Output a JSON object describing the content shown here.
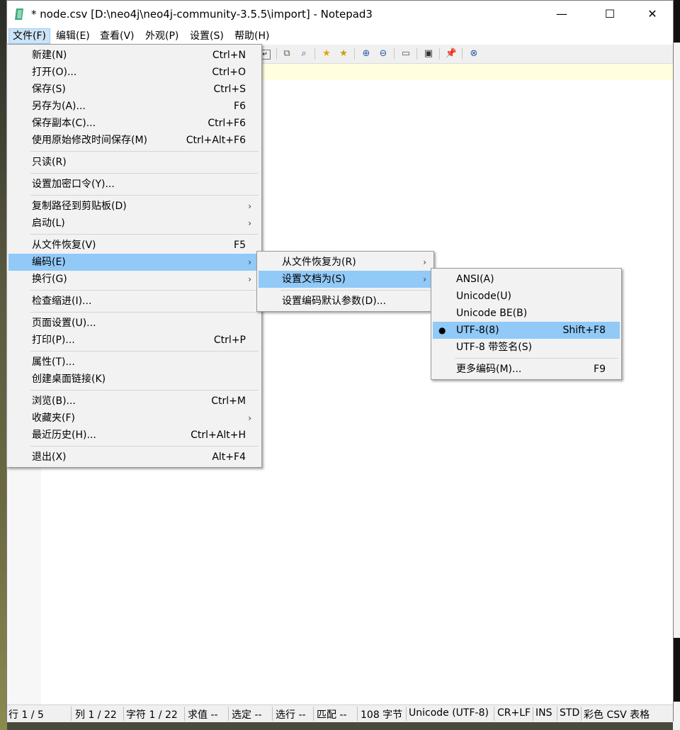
{
  "window": {
    "title": "* node.csv [D:\\neo4j\\neo4j-community-3.5.5\\import] - Notepad3",
    "minimize": "—",
    "maximize": "☐",
    "close": "✕"
  },
  "menubar": [
    "文件(F)",
    "编辑(E)",
    "查看(V)",
    "外观(P)",
    "设置(S)",
    "帮助(H)"
  ],
  "file_menu": [
    {
      "label": "新建(N)",
      "shortcut": "Ctrl+N"
    },
    {
      "label": "打开(O)...",
      "shortcut": "Ctrl+O"
    },
    {
      "label": "保存(S)",
      "shortcut": "Ctrl+S"
    },
    {
      "label": "另存为(A)...",
      "shortcut": "F6"
    },
    {
      "label": "保存副本(C)...",
      "shortcut": "Ctrl+F6"
    },
    {
      "label": "使用原始修改时间保存(M)",
      "shortcut": "Ctrl+Alt+F6"
    },
    {
      "label": "只读(R)",
      "shortcut": ""
    },
    {
      "label": "设置加密口令(Y)...",
      "shortcut": ""
    },
    {
      "label": "复制路径到剪贴板(D)",
      "shortcut": "",
      "submenu": true
    },
    {
      "label": "启动(L)",
      "shortcut": "",
      "submenu": true
    },
    {
      "label": "从文件恢复(V)",
      "shortcut": "F5"
    },
    {
      "label": "编码(E)",
      "shortcut": "",
      "submenu": true,
      "highlighted": true
    },
    {
      "label": "换行(G)",
      "shortcut": "",
      "submenu": true
    },
    {
      "label": "检查缩进(I)...",
      "shortcut": ""
    },
    {
      "label": "页面设置(U)...",
      "shortcut": ""
    },
    {
      "label": "打印(P)...",
      "shortcut": "Ctrl+P"
    },
    {
      "label": "属性(T)...",
      "shortcut": ""
    },
    {
      "label": "创建桌面链接(K)",
      "shortcut": ""
    },
    {
      "label": "浏览(B)...",
      "shortcut": "Ctrl+M"
    },
    {
      "label": "收藏夹(F)",
      "shortcut": "",
      "submenu": true
    },
    {
      "label": "最近历史(H)...",
      "shortcut": "Ctrl+Alt+H"
    },
    {
      "label": "退出(X)",
      "shortcut": "Alt+F4"
    }
  ],
  "encoding_menu": [
    {
      "label": "从文件恢复为(R)",
      "submenu": true
    },
    {
      "label": "设置文档为(S)",
      "submenu": true,
      "highlighted": true
    },
    {
      "label": "设置编码默认参数(D)..."
    }
  ],
  "setdoc_menu": [
    {
      "label": "ANSI(A)",
      "shortcut": ""
    },
    {
      "label": "Unicode(U)",
      "shortcut": ""
    },
    {
      "label": "Unicode BE(B)",
      "shortcut": ""
    },
    {
      "label": "UTF-8(8)",
      "shortcut": "Shift+F8",
      "highlighted": true,
      "checked": true
    },
    {
      "label": "UTF-8 带签名(S)",
      "shortcut": ""
    },
    {
      "label": "更多编码(M)...",
      "shortcut": "F9"
    }
  ],
  "icons": {
    "submenu_arrow": "›",
    "bullet": "●"
  },
  "statusbar": {
    "line": "行 1 / 5",
    "col": "列 1 / 22",
    "char": "字符 1 / 22",
    "eval": "求值 --",
    "sel": "选定 --",
    "selline": "选行 --",
    "match": "匹配 --",
    "bytes": "108 字节",
    "encoding": "Unicode (UTF-8)",
    "eol": "CR+LF",
    "ovr": "INS",
    "mode": "STD",
    "lexer": "彩色 CSV 表格"
  },
  "colors": {
    "menu_highlight": "#91c9f7",
    "menubar_active": "#cce4f7",
    "current_line": "#ffffe0"
  }
}
